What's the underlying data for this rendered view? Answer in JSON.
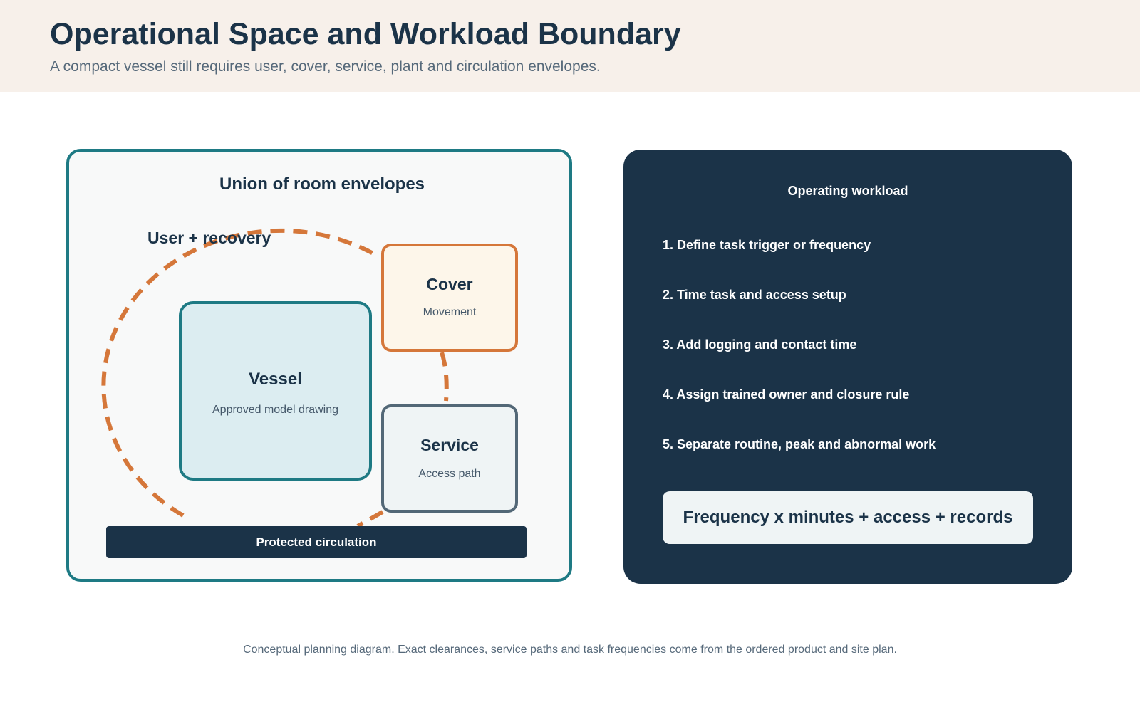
{
  "header": {
    "title": "Operational Space and Workload Boundary",
    "subtitle": "A compact vessel still requires user, cover, service, plant and circulation envelopes."
  },
  "envelopes": {
    "title": "Union of room envelopes",
    "ring_label": "User + recovery",
    "vessel": {
      "title": "Vessel",
      "subtitle": "Approved model drawing"
    },
    "cover": {
      "title": "Cover",
      "subtitle": "Movement"
    },
    "service": {
      "title": "Service",
      "subtitle": "Access path"
    },
    "circulation": "Protected circulation"
  },
  "workload": {
    "title": "Operating workload",
    "steps": [
      "1. Define task trigger or frequency",
      "2. Time task and access setup",
      "3. Add logging and contact time",
      "4. Assign trained owner and closure rule",
      "5. Separate routine, peak and abnormal work"
    ],
    "formula": "Frequency x minutes + access + records"
  },
  "footnote": "Conceptual planning diagram. Exact clearances, service paths and task frequencies come from the ordered product and site plan.",
  "colors": {
    "navy": "#1b3348",
    "teal": "#1e7a84",
    "orange": "#d5773a",
    "slate": "#536877",
    "header_bg": "#f7f0ea"
  }
}
